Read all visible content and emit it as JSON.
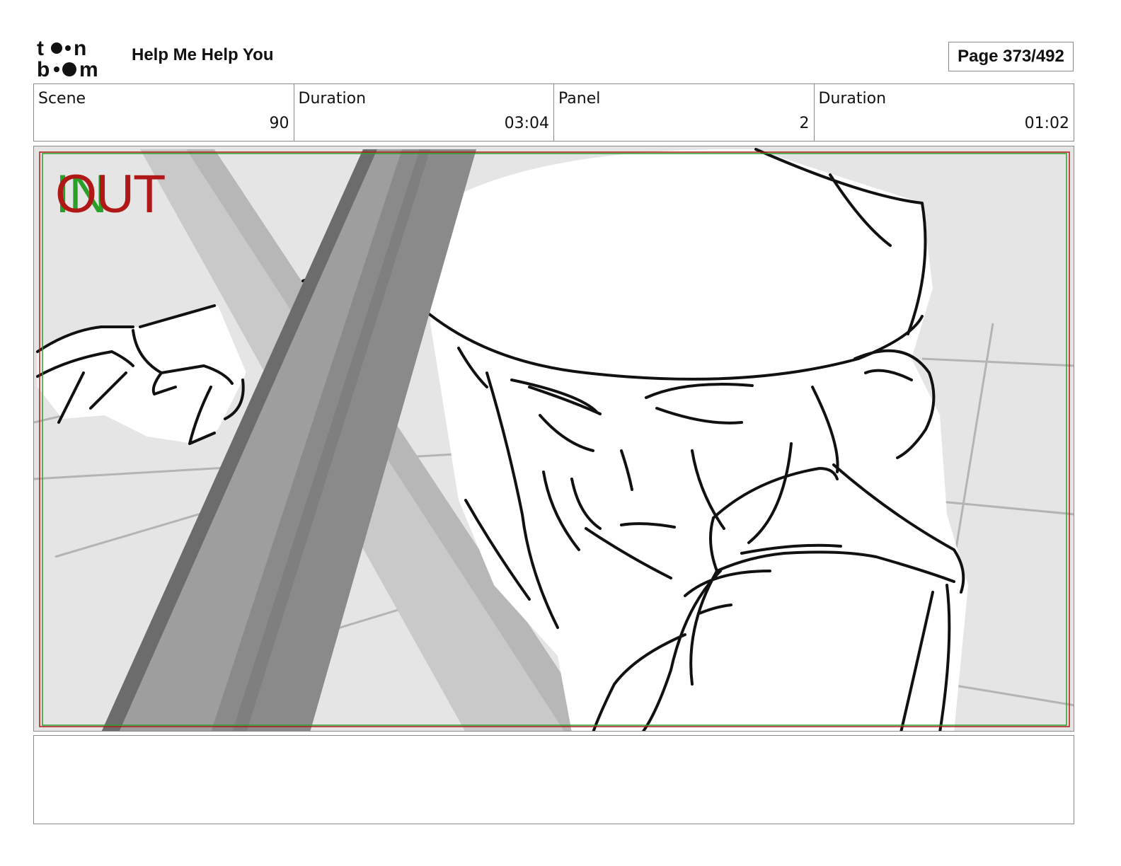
{
  "header": {
    "logo_text": "toon boom",
    "project_title": "Help Me Help You",
    "page_label": "Page 373/492"
  },
  "info": [
    {
      "label": "Scene",
      "value": "90"
    },
    {
      "label": "Duration",
      "value": "03:04"
    },
    {
      "label": "Panel",
      "value": "2"
    },
    {
      "label": "Duration",
      "value": "01:02"
    }
  ],
  "panel": {
    "in_marker": "IN",
    "out_marker": "OUT",
    "in_color": "#2aa02a",
    "out_color": "#b01818",
    "safe_frame_colors": [
      "#b01818",
      "#2aa02a"
    ]
  },
  "notes": {
    "text": ""
  }
}
